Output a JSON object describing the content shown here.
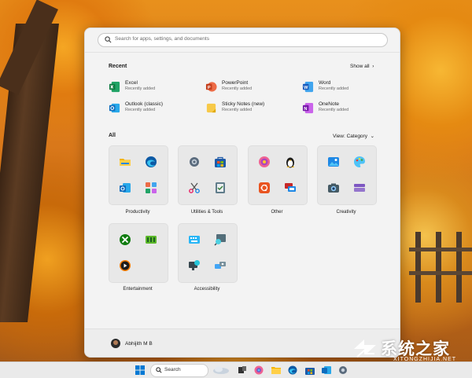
{
  "search": {
    "placeholder": "Search for apps, settings, and documents"
  },
  "recent": {
    "title": "Recent",
    "show_all": "Show all",
    "items": [
      {
        "name": "Excel",
        "sub": "Recently added",
        "icon": "excel-icon"
      },
      {
        "name": "PowerPoint",
        "sub": "Recently added",
        "icon": "powerpoint-icon"
      },
      {
        "name": "Word",
        "sub": "Recently added",
        "icon": "word-icon"
      },
      {
        "name": "Outlook (classic)",
        "sub": "Recently added",
        "icon": "outlook-icon"
      },
      {
        "name": "Sticky Notes (new)",
        "sub": "Recently added",
        "icon": "sticky-notes-icon"
      },
      {
        "name": "OneNote",
        "sub": "Recently added",
        "icon": "onenote-icon"
      }
    ]
  },
  "all": {
    "title": "All",
    "view": "View: Category",
    "folders": [
      {
        "label": "Productivity"
      },
      {
        "label": "Utilities & Tools"
      },
      {
        "label": "Other"
      },
      {
        "label": "Creativity"
      },
      {
        "label": "Entertainment"
      },
      {
        "label": "Accessibility"
      }
    ]
  },
  "user": {
    "name": "Abhijith M B"
  },
  "taskbar": {
    "search": "Search"
  },
  "watermark": {
    "text": "系统之家",
    "url": "XITONGZHIJIA.NET"
  },
  "colors": {
    "accent": "#0067c0",
    "excel": "#107c41",
    "powerpoint": "#c43e1c",
    "word": "#185abd",
    "outlook": "#0f6cbd",
    "onenote": "#7719aa",
    "sticky": "#f7c948"
  }
}
